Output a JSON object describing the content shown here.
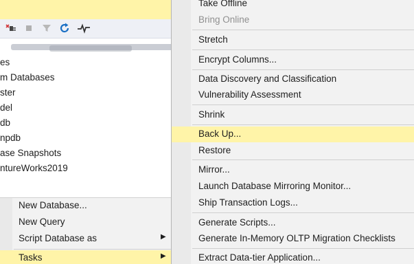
{
  "explorer": {
    "tree_items": [
      "es",
      "m Databases",
      "ster",
      "del",
      "db",
      "npdb",
      "ase Snapshots",
      "ntureWorks2019"
    ]
  },
  "toolbar": {
    "icons": [
      "disconnect-icon",
      "stop-icon",
      "filter-icon",
      "refresh-icon",
      "activity-monitor-icon"
    ]
  },
  "context_menu": {
    "items": [
      {
        "label": "New Database...",
        "has_submenu": false
      },
      {
        "label": "New Query",
        "has_submenu": false
      },
      {
        "label": "Script Database as",
        "has_submenu": true
      },
      {
        "label": "Tasks",
        "has_submenu": true
      }
    ],
    "submenu_arrow": "▶"
  },
  "tasks_menu": {
    "items": [
      {
        "label": "Take Offline",
        "state": "enabled"
      },
      {
        "label": "Bring Online",
        "state": "disabled"
      },
      {
        "label": "Stretch",
        "state": "enabled"
      },
      {
        "label": "Encrypt Columns...",
        "state": "enabled"
      },
      {
        "label": "Data Discovery and Classification",
        "state": "enabled"
      },
      {
        "label": "Vulnerability Assessment",
        "state": "enabled"
      },
      {
        "label": "Shrink",
        "state": "enabled"
      },
      {
        "label": "Back Up...",
        "state": "highlighted"
      },
      {
        "label": "Restore",
        "state": "enabled"
      },
      {
        "label": "Mirror...",
        "state": "enabled"
      },
      {
        "label": "Launch Database Mirroring Monitor...",
        "state": "enabled"
      },
      {
        "label": "Ship Transaction Logs...",
        "state": "enabled"
      },
      {
        "label": "Generate Scripts...",
        "state": "enabled"
      },
      {
        "label": "Generate In-Memory OLTP Migration Checklists",
        "state": "enabled"
      },
      {
        "label": "Extract Data-tier Application...",
        "state": "enabled"
      }
    ]
  },
  "colors": {
    "highlight": "#fff4a8",
    "menu_background": "#f2f2f2",
    "refresh_icon": "#1a6fc4",
    "disconnect_icon": "#d13438"
  }
}
